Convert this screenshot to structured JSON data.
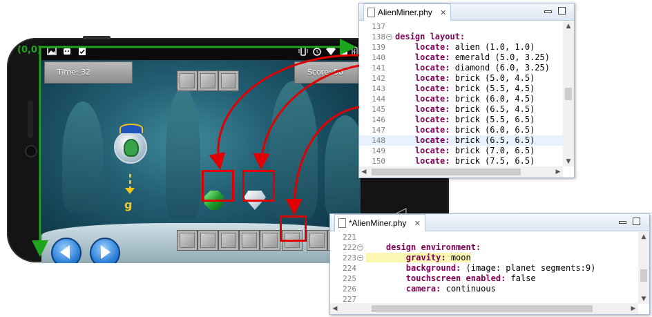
{
  "origin_label": "(0,0)",
  "gravity_symbol": "g",
  "game": {
    "time_label": "Time: 32",
    "score_label": "Score: 50"
  },
  "editor_top": {
    "tab_title": "AlienMiner.phy",
    "close_glyph": "✕",
    "lines": [
      {
        "num": "137",
        "fold": "",
        "text": ""
      },
      {
        "num": "138",
        "fold": "−",
        "text": "design layout:",
        "kw": "design layout:"
      },
      {
        "num": "139",
        "fold": "",
        "kwtext": "    locate:",
        "text": " alien (1.0, 1.0)"
      },
      {
        "num": "140",
        "fold": "",
        "kwtext": "    locate:",
        "text": " emerald (5.0, 3.25)"
      },
      {
        "num": "141",
        "fold": "",
        "kwtext": "    locate:",
        "text": " diamond (6.0, 3.25)"
      },
      {
        "num": "142",
        "fold": "",
        "kwtext": "    locate:",
        "text": " brick (5.0, 4.5)"
      },
      {
        "num": "143",
        "fold": "",
        "kwtext": "    locate:",
        "text": " brick (5.5, 4.5)"
      },
      {
        "num": "144",
        "fold": "",
        "kwtext": "    locate:",
        "text": " brick (6.0, 4.5)"
      },
      {
        "num": "145",
        "fold": "",
        "kwtext": "    locate:",
        "text": " brick (6.5, 4.5)"
      },
      {
        "num": "146",
        "fold": "",
        "kwtext": "    locate:",
        "text": " brick (5.5, 6.5)"
      },
      {
        "num": "147",
        "fold": "",
        "kwtext": "    locate:",
        "text": " brick (6.0, 6.5)"
      },
      {
        "num": "148",
        "fold": "",
        "kwtext": "    locate:",
        "text": " brick (6.5, 6.5)"
      },
      {
        "num": "149",
        "fold": "",
        "kwtext": "    locate:",
        "text": " brick (7.0, 6.5)"
      },
      {
        "num": "150",
        "fold": "",
        "kwtext": "    locate:",
        "text": " brick (7.5, 6.5)"
      }
    ]
  },
  "editor_bottom": {
    "tab_title": "*AlienMiner.phy",
    "close_glyph": "✕",
    "lines": [
      {
        "num": "221",
        "fold": "",
        "text": ""
      },
      {
        "num": "222",
        "fold": "−",
        "kwtext": "    design environment:",
        "text": ""
      },
      {
        "num": "223",
        "fold": "−",
        "kwtext": "        gravity:",
        "text": " moon"
      },
      {
        "num": "224",
        "fold": "",
        "kwtext": "        background:",
        "text": " (image: planet segments:9)"
      },
      {
        "num": "225",
        "fold": "",
        "kwtext": "        touchscreen enabled:",
        "text": " false"
      },
      {
        "num": "226",
        "fold": "",
        "kwtext": "        camera:",
        "text": " continuous"
      },
      {
        "num": "227",
        "fold": "",
        "text": ""
      }
    ]
  },
  "colors": {
    "axis": "#1ea51e",
    "highlight": "#e00000",
    "gravity": "#f5c518",
    "keyword": "#7f0055"
  }
}
